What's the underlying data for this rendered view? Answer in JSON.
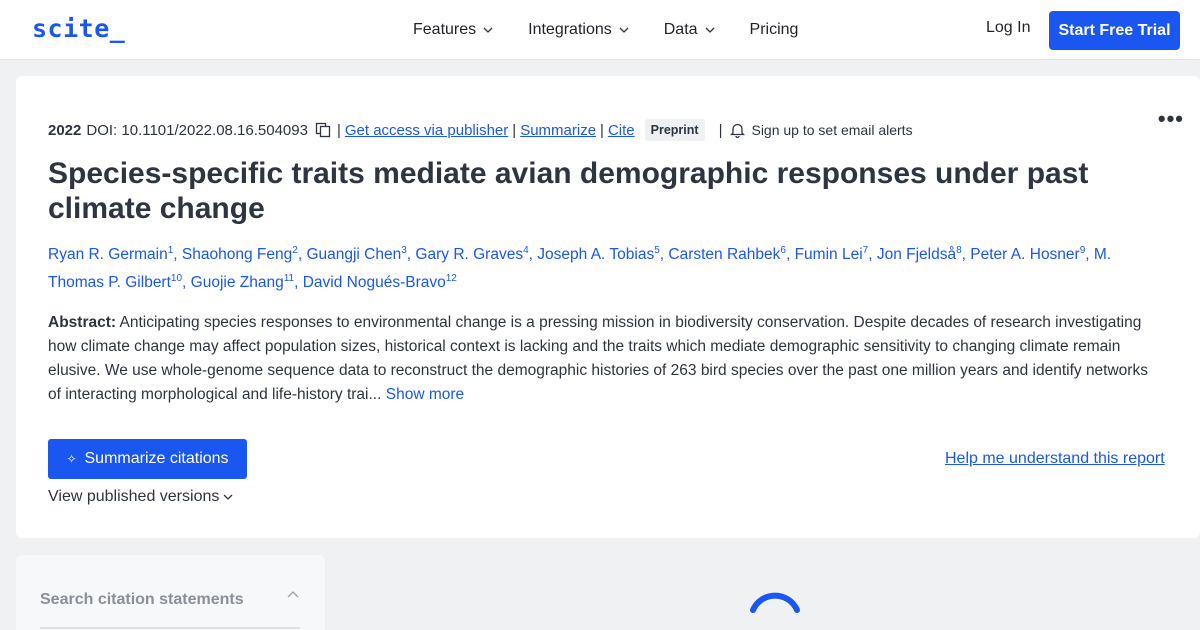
{
  "nav": {
    "logo": "scite_",
    "menu": [
      "Features",
      "Integrations",
      "Data",
      "Pricing"
    ],
    "login": "Log In",
    "trial": "Start Free Trial"
  },
  "paper": {
    "year": "2022",
    "doi": "DOI: 10.1101/2022.08.16.504093",
    "links": {
      "access": "Get access via publisher",
      "summarize": "Summarize",
      "cite": "Cite"
    },
    "badge": "Preprint",
    "alerts": "Sign up to set email alerts",
    "more": "•••",
    "title": "Species-specific traits mediate avian demographic responses under past climate change",
    "authors": [
      {
        "name": "Ryan R. Germain",
        "sup": "1"
      },
      {
        "name": "Shaohong Feng",
        "sup": "2"
      },
      {
        "name": "Guangji Chen",
        "sup": "3"
      },
      {
        "name": "Gary R. Graves",
        "sup": "4"
      },
      {
        "name": "Joseph A. Tobias",
        "sup": "5"
      },
      {
        "name": "Carsten Rahbek",
        "sup": "6"
      },
      {
        "name": "Fumin Lei",
        "sup": "7"
      },
      {
        "name": "Jon Fjeldså",
        "sup": "8"
      },
      {
        "name": "Peter A. Hosner",
        "sup": "9"
      },
      {
        "name": "M. Thomas P. Gilbert",
        "sup": "10"
      },
      {
        "name": "Guojie Zhang",
        "sup": "11"
      },
      {
        "name": "David Nogués-Bravo",
        "sup": "12"
      }
    ],
    "abstract_label": "Abstract:",
    "abstract": "Anticipating species responses to environmental change is a pressing mission in biodiversity conservation. Despite decades of research investigating how climate change may affect population sizes, historical context is lacking and the traits which mediate demographic sensitivity to changing climate remain elusive. We use whole-genome sequence data to reconstruct the demographic histories of 263 bird species over the past one million years and identify networks of interacting morphological and life-history trai...",
    "show_more": "Show more",
    "summarize_btn": "Summarize citations",
    "help_link": "Help me understand this report",
    "versions": "View published versions"
  },
  "search": {
    "label": "Search citation statements"
  },
  "colors": {
    "accent": "#1a56f0",
    "text": "#2e3440",
    "background": "#f0f1f3"
  },
  "icons": [
    "chevron-down-icon",
    "copy-icon",
    "bell-icon",
    "wand-icon",
    "chevron-up-icon",
    "loading-spinner"
  ]
}
